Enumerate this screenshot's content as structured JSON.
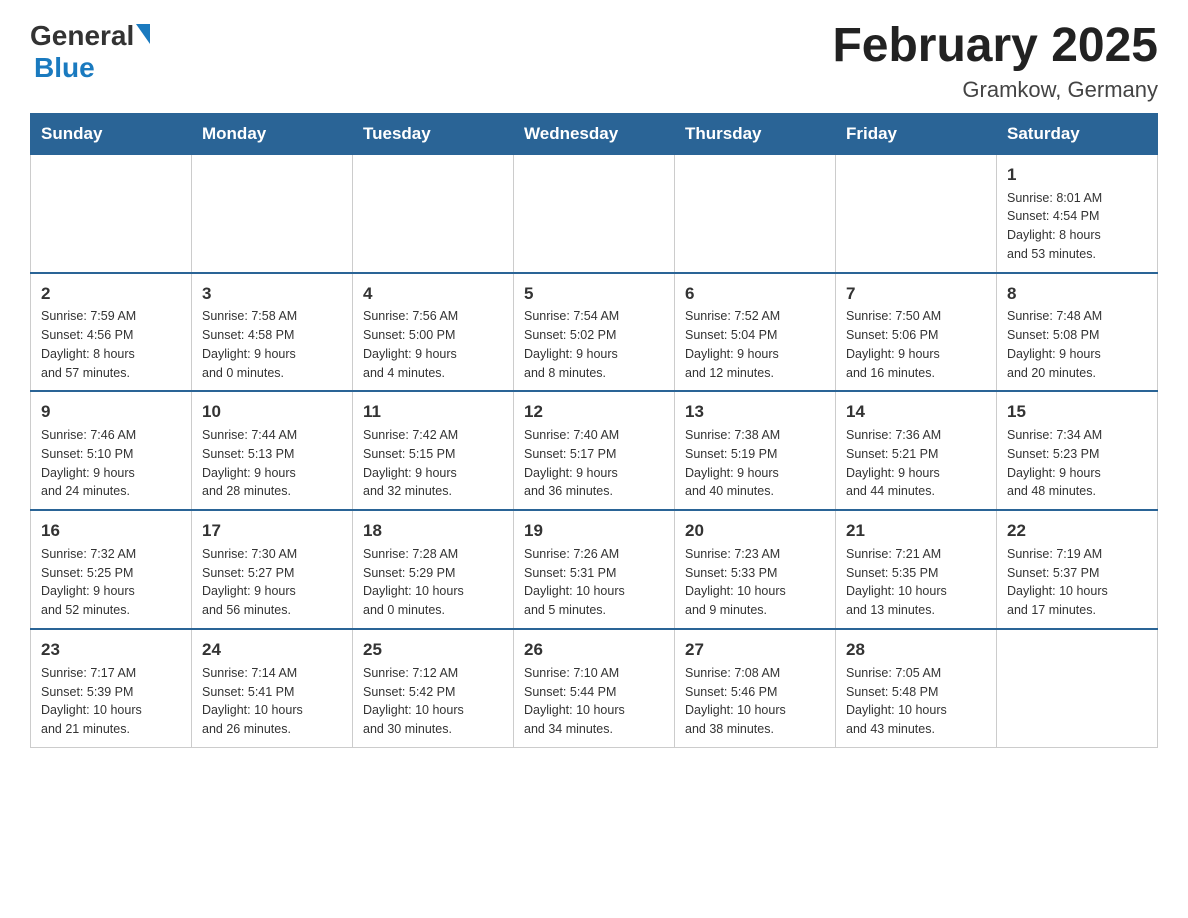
{
  "header": {
    "logo_general": "General",
    "logo_blue": "Blue",
    "title": "February 2025",
    "subtitle": "Gramkow, Germany"
  },
  "weekdays": [
    "Sunday",
    "Monday",
    "Tuesday",
    "Wednesday",
    "Thursday",
    "Friday",
    "Saturday"
  ],
  "weeks": [
    [
      {
        "day": "",
        "info": ""
      },
      {
        "day": "",
        "info": ""
      },
      {
        "day": "",
        "info": ""
      },
      {
        "day": "",
        "info": ""
      },
      {
        "day": "",
        "info": ""
      },
      {
        "day": "",
        "info": ""
      },
      {
        "day": "1",
        "info": "Sunrise: 8:01 AM\nSunset: 4:54 PM\nDaylight: 8 hours\nand 53 minutes."
      }
    ],
    [
      {
        "day": "2",
        "info": "Sunrise: 7:59 AM\nSunset: 4:56 PM\nDaylight: 8 hours\nand 57 minutes."
      },
      {
        "day": "3",
        "info": "Sunrise: 7:58 AM\nSunset: 4:58 PM\nDaylight: 9 hours\nand 0 minutes."
      },
      {
        "day": "4",
        "info": "Sunrise: 7:56 AM\nSunset: 5:00 PM\nDaylight: 9 hours\nand 4 minutes."
      },
      {
        "day": "5",
        "info": "Sunrise: 7:54 AM\nSunset: 5:02 PM\nDaylight: 9 hours\nand 8 minutes."
      },
      {
        "day": "6",
        "info": "Sunrise: 7:52 AM\nSunset: 5:04 PM\nDaylight: 9 hours\nand 12 minutes."
      },
      {
        "day": "7",
        "info": "Sunrise: 7:50 AM\nSunset: 5:06 PM\nDaylight: 9 hours\nand 16 minutes."
      },
      {
        "day": "8",
        "info": "Sunrise: 7:48 AM\nSunset: 5:08 PM\nDaylight: 9 hours\nand 20 minutes."
      }
    ],
    [
      {
        "day": "9",
        "info": "Sunrise: 7:46 AM\nSunset: 5:10 PM\nDaylight: 9 hours\nand 24 minutes."
      },
      {
        "day": "10",
        "info": "Sunrise: 7:44 AM\nSunset: 5:13 PM\nDaylight: 9 hours\nand 28 minutes."
      },
      {
        "day": "11",
        "info": "Sunrise: 7:42 AM\nSunset: 5:15 PM\nDaylight: 9 hours\nand 32 minutes."
      },
      {
        "day": "12",
        "info": "Sunrise: 7:40 AM\nSunset: 5:17 PM\nDaylight: 9 hours\nand 36 minutes."
      },
      {
        "day": "13",
        "info": "Sunrise: 7:38 AM\nSunset: 5:19 PM\nDaylight: 9 hours\nand 40 minutes."
      },
      {
        "day": "14",
        "info": "Sunrise: 7:36 AM\nSunset: 5:21 PM\nDaylight: 9 hours\nand 44 minutes."
      },
      {
        "day": "15",
        "info": "Sunrise: 7:34 AM\nSunset: 5:23 PM\nDaylight: 9 hours\nand 48 minutes."
      }
    ],
    [
      {
        "day": "16",
        "info": "Sunrise: 7:32 AM\nSunset: 5:25 PM\nDaylight: 9 hours\nand 52 minutes."
      },
      {
        "day": "17",
        "info": "Sunrise: 7:30 AM\nSunset: 5:27 PM\nDaylight: 9 hours\nand 56 minutes."
      },
      {
        "day": "18",
        "info": "Sunrise: 7:28 AM\nSunset: 5:29 PM\nDaylight: 10 hours\nand 0 minutes."
      },
      {
        "day": "19",
        "info": "Sunrise: 7:26 AM\nSunset: 5:31 PM\nDaylight: 10 hours\nand 5 minutes."
      },
      {
        "day": "20",
        "info": "Sunrise: 7:23 AM\nSunset: 5:33 PM\nDaylight: 10 hours\nand 9 minutes."
      },
      {
        "day": "21",
        "info": "Sunrise: 7:21 AM\nSunset: 5:35 PM\nDaylight: 10 hours\nand 13 minutes."
      },
      {
        "day": "22",
        "info": "Sunrise: 7:19 AM\nSunset: 5:37 PM\nDaylight: 10 hours\nand 17 minutes."
      }
    ],
    [
      {
        "day": "23",
        "info": "Sunrise: 7:17 AM\nSunset: 5:39 PM\nDaylight: 10 hours\nand 21 minutes."
      },
      {
        "day": "24",
        "info": "Sunrise: 7:14 AM\nSunset: 5:41 PM\nDaylight: 10 hours\nand 26 minutes."
      },
      {
        "day": "25",
        "info": "Sunrise: 7:12 AM\nSunset: 5:42 PM\nDaylight: 10 hours\nand 30 minutes."
      },
      {
        "day": "26",
        "info": "Sunrise: 7:10 AM\nSunset: 5:44 PM\nDaylight: 10 hours\nand 34 minutes."
      },
      {
        "day": "27",
        "info": "Sunrise: 7:08 AM\nSunset: 5:46 PM\nDaylight: 10 hours\nand 38 minutes."
      },
      {
        "day": "28",
        "info": "Sunrise: 7:05 AM\nSunset: 5:48 PM\nDaylight: 10 hours\nand 43 minutes."
      },
      {
        "day": "",
        "info": ""
      }
    ]
  ]
}
